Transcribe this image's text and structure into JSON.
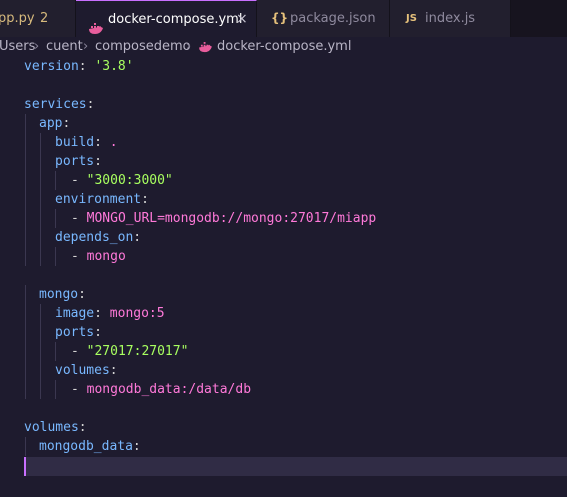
{
  "tabs": [
    {
      "label": "pp.py",
      "badge": "2"
    },
    {
      "label": "docker-compose.yml",
      "close": "×"
    },
    {
      "icon_text": "{}",
      "label": "package.json"
    },
    {
      "icon_text": "JS",
      "label": "index.js"
    }
  ],
  "breadcrumb": [
    "Users",
    "cuent",
    "composedemo",
    "docker-compose.yml"
  ],
  "breadcrumb_sep": "›",
  "code": {
    "l1": {
      "k": "version",
      "p": ": ",
      "v": "'3.8'"
    },
    "l3": {
      "k": "services",
      "p": ":"
    },
    "l4": {
      "k": "app",
      "p": ":"
    },
    "l5": {
      "k": "build",
      "p": ": ",
      "v": "."
    },
    "l6": {
      "k": "ports",
      "p": ":"
    },
    "l7": {
      "p": "- ",
      "v": "\"3000:3000\""
    },
    "l8": {
      "k": "environment",
      "p": ":"
    },
    "l9": {
      "p": "- ",
      "v": "MONGO_URL=mongodb://mongo:27017/miapp"
    },
    "l10": {
      "k": "depends_on",
      "p": ":"
    },
    "l11": {
      "p": "- ",
      "v": "mongo"
    },
    "l13": {
      "k": "mongo",
      "p": ":"
    },
    "l14": {
      "k": "image",
      "p": ": ",
      "v": "mongo:5"
    },
    "l15": {
      "k": "ports",
      "p": ":"
    },
    "l16": {
      "p": "- ",
      "v": "\"27017:27017\""
    },
    "l17": {
      "k": "volumes",
      "p": ":"
    },
    "l18": {
      "p": "- ",
      "v": "mongodb_data:/data/db"
    },
    "l20": {
      "k": "volumes",
      "p": ":"
    },
    "l21": {
      "k": "mongodb_data",
      "p": ":"
    }
  },
  "colors": {
    "accent": "#c86fff",
    "key": "#79b8ff",
    "string": "#a8ff60",
    "value": "#ff79d9",
    "warning": "#d7ba7d"
  },
  "icons": [
    "docker-whale-icon",
    "json-braces-icon",
    "js-file-icon",
    "close-icon",
    "chevron-right-icon"
  ]
}
